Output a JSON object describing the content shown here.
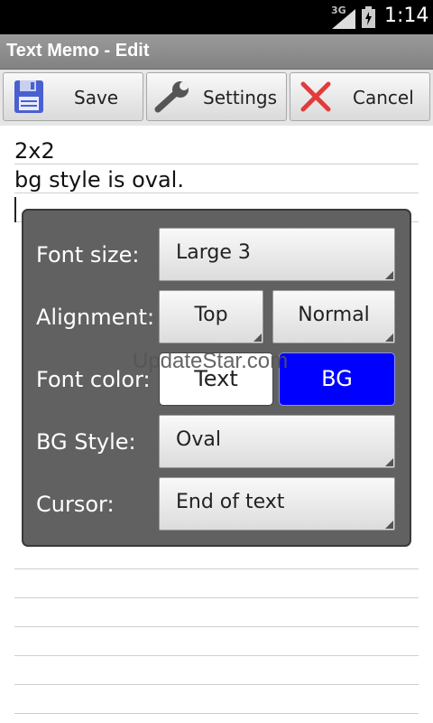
{
  "status_bar": {
    "network": "3G",
    "time": "1:14"
  },
  "app": {
    "title": "Text Memo - Edit"
  },
  "toolbar": {
    "save_label": "Save",
    "settings_label": "Settings",
    "cancel_label": "Cancel"
  },
  "memo": {
    "lines": [
      "2x2",
      "bg style is oval."
    ]
  },
  "dialog": {
    "font_size_label": "Font size:",
    "font_size_value": "Large 3",
    "alignment_label": "Alignment:",
    "alignment_vertical": "Top",
    "alignment_horizontal": "Normal",
    "font_color_label": "Font color:",
    "text_color_button": "Text",
    "bg_color_button": "BG",
    "bg_style_label": "BG Style:",
    "bg_style_value": "Oval",
    "cursor_label": "Cursor:",
    "cursor_value": "End of text"
  },
  "colors": {
    "bg_button": "#0000ff",
    "text_button": "#ffffff",
    "dialog_bg": "#616161"
  },
  "watermark": "UpdateStar.com"
}
